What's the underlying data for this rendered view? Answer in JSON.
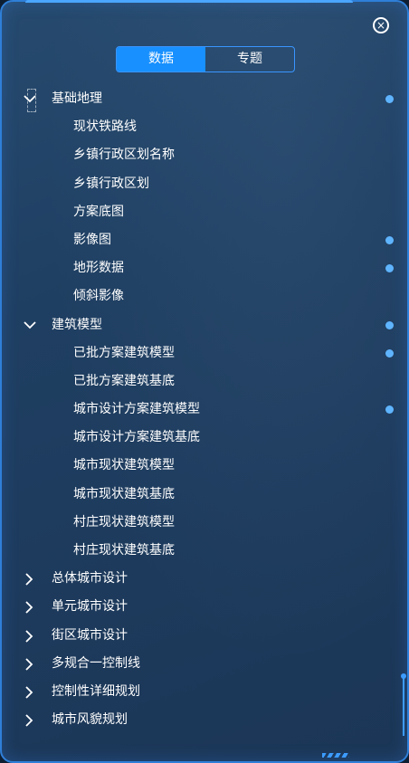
{
  "tabs": [
    {
      "label": "数据",
      "active": true
    },
    {
      "label": "专题",
      "active": false
    }
  ],
  "tree": [
    {
      "label": "基础地理",
      "expanded": true,
      "dot": true,
      "children": [
        {
          "label": "现状铁路线",
          "dot": false
        },
        {
          "label": "乡镇行政区划名称",
          "dot": false
        },
        {
          "label": "乡镇行政区划",
          "dot": false
        },
        {
          "label": "方案底图",
          "dot": false
        },
        {
          "label": "影像图",
          "dot": true
        },
        {
          "label": "地形数据",
          "dot": true
        },
        {
          "label": "倾斜影像",
          "dot": false
        }
      ]
    },
    {
      "label": "建筑模型",
      "expanded": true,
      "dot": true,
      "children": [
        {
          "label": "已批方案建筑模型",
          "dot": true
        },
        {
          "label": "已批方案建筑基底",
          "dot": false
        },
        {
          "label": "城市设计方案建筑模型",
          "dot": true
        },
        {
          "label": "城市设计方案建筑基底",
          "dot": false
        },
        {
          "label": "城市现状建筑模型",
          "dot": false
        },
        {
          "label": "城市现状建筑基底",
          "dot": false
        },
        {
          "label": "村庄现状建筑模型",
          "dot": false
        },
        {
          "label": "村庄现状建筑基底",
          "dot": false
        }
      ]
    },
    {
      "label": "总体城市设计",
      "expanded": false,
      "dot": false,
      "children": []
    },
    {
      "label": "单元城市设计",
      "expanded": false,
      "dot": false,
      "children": []
    },
    {
      "label": "街区城市设计",
      "expanded": false,
      "dot": false,
      "children": []
    },
    {
      "label": "多规合一控制线",
      "expanded": false,
      "dot": false,
      "children": []
    },
    {
      "label": "控制性详细规划",
      "expanded": false,
      "dot": false,
      "children": []
    },
    {
      "label": "城市风貌规划",
      "expanded": false,
      "dot": false,
      "children": []
    }
  ],
  "icons": {
    "close": "close-circle-icon",
    "expanded": "chevron-down-icon",
    "collapsed": "chevron-right-icon",
    "dot": "layer-status-dot"
  },
  "colors": {
    "accent": "#1890ff",
    "dot": "#5fb4ff",
    "border": "#2f7fd8"
  }
}
